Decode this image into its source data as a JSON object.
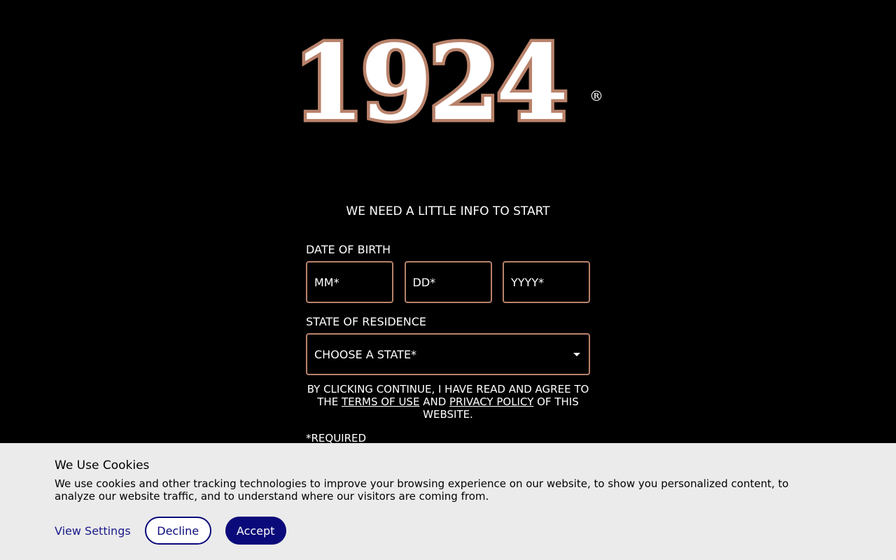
{
  "brand": {
    "logo_text": "1924",
    "registered_mark": "®"
  },
  "form": {
    "heading": "WE NEED A LITTLE INFO TO START",
    "dob_label": "DATE OF BIRTH",
    "month_placeholder": "MM*",
    "day_placeholder": "DD*",
    "year_placeholder": "YYYY*",
    "state_label": "STATE OF RESIDENCE",
    "state_placeholder": "CHOOSE A STATE*",
    "consent_prefix": "BY CLICKING CONTINUE, I HAVE READ AND AGREE TO THE ",
    "terms_link": "TERMS OF USE",
    "consent_and": " AND ",
    "privacy_link": "PRIVACY POLICY",
    "consent_suffix": " OF THIS WEBSITE.",
    "required_note": "*REQUIRED"
  },
  "cookies": {
    "title": "We Use Cookies",
    "body": "We use cookies and other tracking technologies to improve your browsing experience on our website, to show you personalized content, to analyze our website traffic, and to understand where our visitors are coming from.",
    "view_settings_label": "View Settings",
    "decline_label": "Decline",
    "accept_label": "Accept"
  },
  "colors": {
    "background": "#000000",
    "accent_copper": "#b8826a",
    "banner_bg": "#ebebeb",
    "button_navy": "#0a0a7a"
  }
}
